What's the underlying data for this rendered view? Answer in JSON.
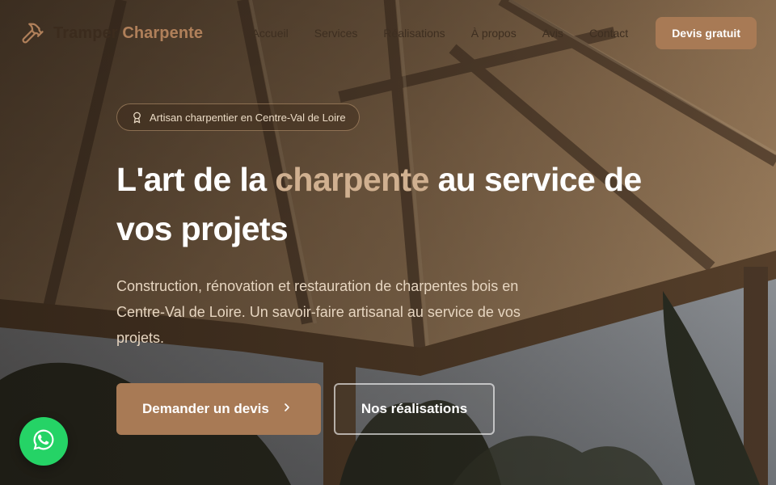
{
  "brand": {
    "name_first": "Tramper",
    "name_second": "Charpente",
    "logo_icon": "hammer-icon",
    "accent_color": "#a87a55"
  },
  "nav": {
    "links": [
      "Accueil",
      "Services",
      "Réalisations",
      "À propos",
      "Avis",
      "Contact"
    ],
    "cta_label": "Devis gratuit"
  },
  "hero": {
    "badge_icon": "award-icon",
    "badge_text": "Artisan charpentier en Centre-Val de Loire",
    "headline_before": "L'art de la ",
    "headline_accent": "charpente",
    "headline_after": " au service de vos projets",
    "subtitle": "Construction, rénovation et restauration de charpentes bois en Centre-Val de Loire. Un savoir-faire artisanal au service de vos projets.",
    "primary_button": "Demander un devis",
    "primary_button_icon": "chevron-right-icon",
    "secondary_button": "Nos réalisations"
  },
  "floating": {
    "whatsapp_icon": "whatsapp-icon",
    "whatsapp_color": "#25d366"
  }
}
